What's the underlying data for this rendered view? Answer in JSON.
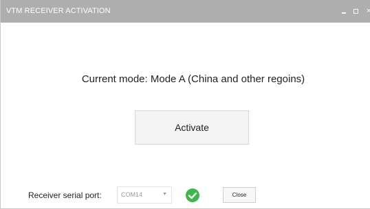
{
  "window": {
    "title": "VTM RECEIVER ACTIVATION",
    "controls": {
      "minimize_icon": "minimize-icon",
      "maximize_icon": "maximize-icon",
      "close_icon": "close-icon",
      "close_glyph": "×"
    }
  },
  "main": {
    "mode_text": "Current mode: Mode A (China and other regoins)",
    "activate_label": "Activate"
  },
  "footer": {
    "port_label": "Receiver serial port:",
    "port_value": "COM14",
    "status_icon": "check-circle-icon",
    "close_label": "Close"
  },
  "colors": {
    "titlebar": "#aeaeae",
    "success": "#3cb84a"
  }
}
